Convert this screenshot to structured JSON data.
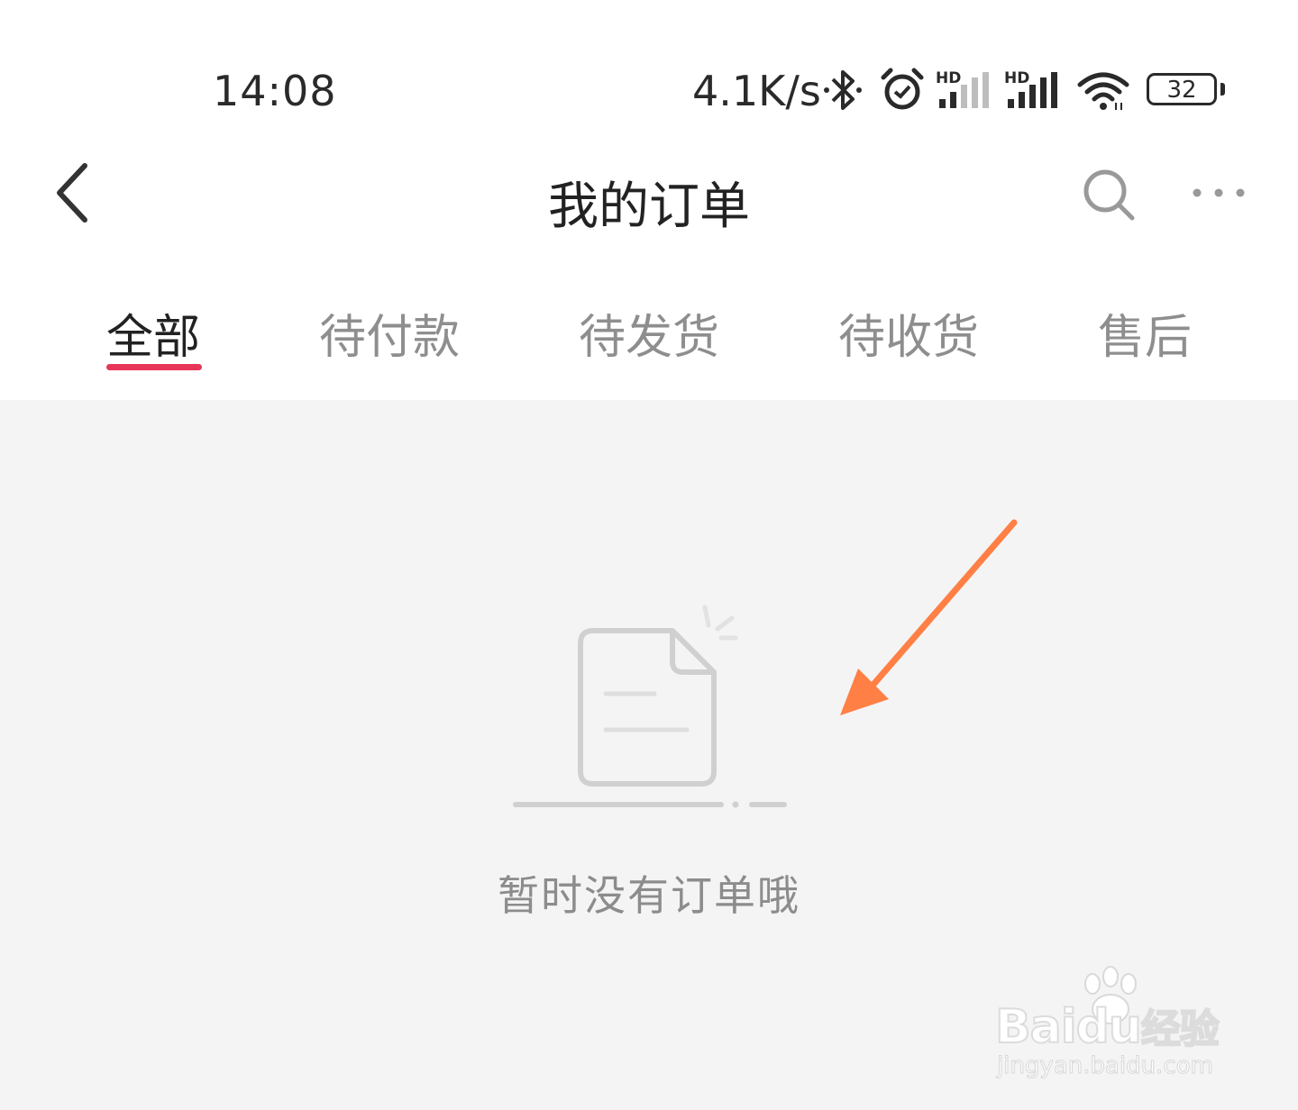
{
  "status_bar": {
    "time": "14:08",
    "net_speed": "4.1K/s",
    "battery": "32",
    "icons": [
      "bluetooth-icon",
      "alarm-icon",
      "hd-signal-icon",
      "hd-signal-icon",
      "wifi-icon",
      "battery-icon"
    ]
  },
  "nav": {
    "title": "我的订单",
    "icons": [
      "back-chevron-icon",
      "search-icon",
      "more-icon"
    ]
  },
  "tabs": [
    {
      "label": "全部",
      "active": true
    },
    {
      "label": "待付款",
      "active": false
    },
    {
      "label": "待发货",
      "active": false
    },
    {
      "label": "待收货",
      "active": false
    },
    {
      "label": "售后",
      "active": false
    }
  ],
  "empty_state": {
    "message": "暂时没有订单哦",
    "icon": "empty-document-icon"
  },
  "annotation": {
    "icon": "arrow-icon",
    "color": "#ff7f45"
  },
  "watermark": {
    "brand": "Bai",
    "brand_suffix": "du",
    "brand_cn": "经验",
    "url": "jingyan.baidu.com"
  },
  "colors": {
    "accent": "#e8355a",
    "background": "#f4f4f4",
    "tab_inactive": "#8e8e8e"
  }
}
